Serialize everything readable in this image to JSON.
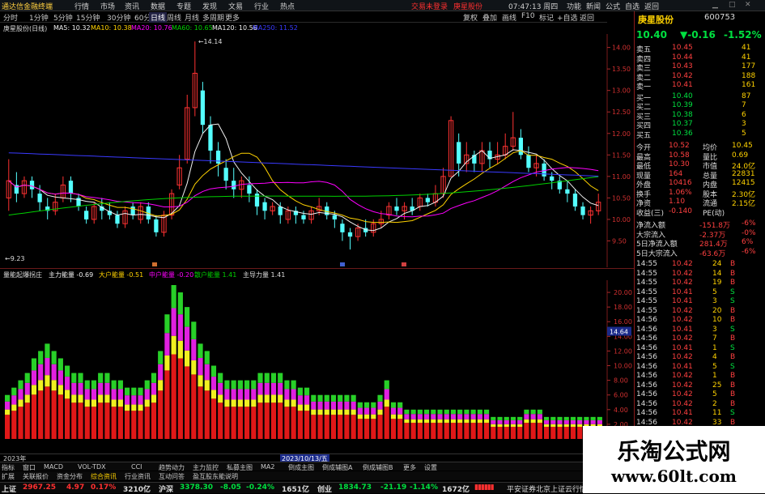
{
  "menubar": {
    "app_title": "通达信金融终端",
    "items": [
      "行情",
      "市场",
      "资讯",
      "数据",
      "专题",
      "发现",
      "文易",
      "行业",
      "热点"
    ],
    "login_links": [
      "交易未登录",
      "庚星股份"
    ],
    "right_items": [
      "功能",
      "新闻",
      "公式",
      "自选",
      "返回"
    ],
    "time": "07:47:13 周四"
  },
  "period_tabs": [
    "分时",
    "1分钟",
    "5分钟",
    "15分钟",
    "30分钟",
    "60分钟",
    "日线",
    "周线",
    "月线",
    "多周期",
    "更多"
  ],
  "period_right": [
    "复权",
    "叠加",
    "画线",
    "F10",
    "标记",
    "+自选",
    "返回"
  ],
  "ma_legend": {
    "name": "庚星股份(日线)",
    "ma5": "MA5: 10.32",
    "ma10": "MA10: 10.38",
    "ma20": "MA20: 10.76",
    "ma60": "MA60: 10.65",
    "ma120": "MA120: 10.56",
    "ma250": "MA250: 11.52"
  },
  "price_axis": [
    "14.00",
    "13.50",
    "13.00",
    "12.50",
    "12.00",
    "11.50",
    "11.00",
    "10.50",
    "10.00",
    "9.50"
  ],
  "chart_annotations": {
    "high": "14.14",
    "low": "9.23"
  },
  "chart_data": {
    "type": "candlestick",
    "ylim": [
      9.0,
      14.2
    ],
    "candles": [
      [
        10.5,
        10.9,
        10.2,
        11.4
      ],
      [
        10.8,
        10.6,
        10.4,
        11.1
      ],
      [
        10.6,
        10.9,
        10.5,
        11.0
      ],
      [
        10.9,
        10.7,
        10.5,
        11.0
      ],
      [
        10.6,
        10.4,
        10.2,
        10.8
      ],
      [
        10.3,
        10.2,
        10.0,
        10.5
      ],
      [
        10.2,
        10.4,
        10.1,
        10.6
      ],
      [
        10.5,
        10.8,
        10.4,
        11.0
      ],
      [
        10.9,
        10.6,
        10.4,
        11.0
      ],
      [
        10.5,
        10.3,
        10.2,
        10.6
      ],
      [
        10.2,
        10.0,
        9.9,
        10.3
      ],
      [
        10.0,
        10.3,
        9.9,
        10.4
      ],
      [
        10.3,
        10.2,
        10.0,
        10.5
      ],
      [
        10.2,
        10.1,
        10.0,
        10.4
      ],
      [
        10.1,
        9.9,
        9.8,
        10.2
      ],
      [
        9.9,
        10.2,
        9.8,
        10.3
      ],
      [
        10.3,
        10.1,
        10.0,
        10.4
      ],
      [
        10.0,
        10.3,
        9.9,
        10.4
      ],
      [
        10.3,
        10.0,
        9.9,
        10.4
      ],
      [
        10.0,
        9.7,
        9.6,
        10.1
      ],
      [
        9.7,
        10.1,
        9.6,
        10.2
      ],
      [
        10.1,
        10.6,
        10.0,
        10.7
      ],
      [
        10.8,
        11.2,
        10.7,
        11.5
      ],
      [
        11.4,
        12.6,
        11.3,
        12.9
      ],
      [
        12.6,
        13.4,
        12.4,
        14.14
      ],
      [
        13.0,
        12.2,
        12.0,
        13.2
      ],
      [
        12.2,
        11.6,
        11.3,
        12.4
      ],
      [
        11.6,
        11.3,
        11.0,
        11.8
      ],
      [
        11.2,
        10.9,
        10.7,
        11.4
      ],
      [
        10.9,
        10.7,
        10.5,
        11.2
      ],
      [
        10.7,
        10.9,
        10.5,
        11.0
      ],
      [
        10.8,
        10.6,
        10.4,
        11.0
      ],
      [
        10.6,
        10.3,
        10.1,
        10.7
      ],
      [
        10.4,
        10.2,
        10.0,
        10.5
      ],
      [
        10.2,
        10.3,
        10.1,
        10.4
      ],
      [
        10.3,
        10.1,
        9.9,
        10.4
      ],
      [
        10.0,
        10.2,
        9.9,
        10.3
      ],
      [
        10.2,
        10.1,
        9.9,
        10.3
      ],
      [
        10.1,
        10.0,
        9.9,
        10.2
      ],
      [
        10.0,
        10.2,
        9.9,
        10.3
      ],
      [
        10.2,
        10.3,
        10.1,
        10.5
      ],
      [
        10.3,
        10.1,
        10.0,
        10.4
      ],
      [
        10.1,
        10.0,
        9.8,
        10.2
      ],
      [
        9.9,
        9.7,
        9.5,
        10.0
      ],
      [
        9.7,
        9.6,
        9.3,
        9.8
      ],
      [
        9.6,
        9.8,
        9.5,
        9.9
      ],
      [
        9.8,
        9.7,
        9.6,
        10.0
      ],
      [
        9.7,
        9.9,
        9.6,
        10.0
      ],
      [
        9.9,
        10.0,
        9.8,
        10.2
      ],
      [
        10.1,
        10.3,
        10.0,
        10.4
      ],
      [
        10.3,
        10.2,
        10.1,
        10.5
      ],
      [
        10.2,
        10.3,
        10.0,
        10.4
      ],
      [
        10.3,
        10.2,
        10.1,
        10.5
      ],
      [
        10.3,
        10.5,
        10.2,
        10.6
      ],
      [
        10.5,
        10.4,
        10.3,
        10.6
      ],
      [
        10.4,
        10.6,
        10.3,
        10.8
      ],
      [
        10.6,
        11.0,
        10.5,
        11.2
      ],
      [
        11.0,
        12.3,
        11.0,
        12.4
      ],
      [
        11.8,
        11.3,
        11.0,
        12.0
      ],
      [
        11.3,
        11.5,
        11.1,
        11.8
      ],
      [
        11.5,
        11.3,
        11.1,
        11.6
      ],
      [
        11.3,
        11.6,
        11.1,
        11.8
      ],
      [
        11.6,
        11.4,
        11.2,
        11.8
      ],
      [
        11.4,
        11.5,
        11.3,
        11.8
      ],
      [
        11.5,
        11.7,
        11.4,
        12.0
      ],
      [
        11.7,
        11.9,
        11.6,
        12.5
      ],
      [
        11.9,
        11.5,
        11.4,
        12.1
      ],
      [
        11.5,
        11.2,
        11.1,
        11.7
      ],
      [
        11.2,
        11.3,
        11.0,
        11.5
      ],
      [
        11.3,
        11.0,
        10.9,
        11.4
      ],
      [
        11.0,
        10.9,
        10.7,
        11.1
      ],
      [
        10.9,
        10.7,
        10.6,
        11.0
      ],
      [
        10.7,
        10.6,
        10.4,
        10.9
      ],
      [
        10.6,
        10.3,
        10.2,
        10.7
      ],
      [
        10.3,
        10.1,
        10.0,
        10.4
      ],
      [
        10.1,
        10.2,
        9.9,
        10.3
      ],
      [
        10.2,
        10.4,
        10.1,
        10.6
      ]
    ],
    "ma_lines": [
      {
        "name": "MA5",
        "color": "#f0f0f0"
      },
      {
        "name": "MA10",
        "color": "#ffd200"
      },
      {
        "name": "MA20",
        "color": "#ff00ff"
      },
      {
        "name": "MA60",
        "color": "#00d000"
      },
      {
        "name": "MA120",
        "color": "#3a3aff"
      }
    ]
  },
  "date_markers": [
    "2023年",
    "2023/10/13/五"
  ],
  "indicator_legend": {
    "name": "量能起爆拐庄",
    "main": "主力能量 -0.69",
    "big": "大户能量 -0.51",
    "mid": "中户能量 -0.20",
    "retail": "散户能量 1.41",
    "leader": "主导力量 1.41"
  },
  "indicator_axis": [
    "20.00",
    "18.00",
    "16.00",
    "14.00",
    "12.00",
    "10.00",
    "8.00",
    "6.00",
    "4.00",
    "2.00"
  ],
  "indicator_tag": "14.64",
  "indicator_tag2": "3.0",
  "indicator_data": {
    "total": [
      6,
      7,
      8,
      9,
      11,
      12,
      13,
      12,
      11,
      10,
      9,
      9,
      8,
      8,
      9,
      9,
      8,
      8,
      7,
      7,
      7,
      8,
      9,
      12,
      17,
      21,
      20,
      18,
      16,
      13,
      12,
      10,
      9,
      8,
      8,
      8,
      8,
      8,
      9,
      9,
      9,
      9,
      8,
      8,
      7,
      7,
      6,
      6,
      6,
      6,
      6,
      6,
      6,
      5,
      5,
      5,
      6,
      8,
      5,
      5,
      4,
      4,
      4,
      4,
      4,
      4,
      4,
      4,
      4,
      4,
      4,
      4,
      4,
      3,
      3,
      3,
      3,
      3,
      4,
      4,
      4,
      3,
      3,
      3,
      3,
      3,
      3,
      3,
      3,
      3
    ],
    "red_ratio": 0.55,
    "yellow_ratio": 0.12,
    "magenta_ratio": 0.18
  },
  "right_panel": {
    "title": "庚星股份",
    "code": "600753",
    "price": "10.40",
    "change": "▼-0.16",
    "change_pct": "-1.52%",
    "asks": [
      [
        "卖五",
        "10.45",
        "41"
      ],
      [
        "卖四",
        "10.44",
        "41"
      ],
      [
        "卖三",
        "10.43",
        "177"
      ],
      [
        "卖二",
        "10.42",
        "188"
      ],
      [
        "卖一",
        "10.41",
        "161"
      ]
    ],
    "bids": [
      [
        "买一",
        "10.40",
        "87"
      ],
      [
        "买二",
        "10.39",
        "7"
      ],
      [
        "买三",
        "10.38",
        "6"
      ],
      [
        "买四",
        "10.37",
        "3"
      ],
      [
        "买五",
        "10.36",
        "5"
      ]
    ],
    "stats": [
      [
        "今开",
        "10.52",
        "均价",
        "10.45"
      ],
      [
        "最高",
        "10.58",
        "量比",
        "0.69"
      ],
      [
        "最低",
        "10.30",
        "市值",
        "24.0亿"
      ],
      [
        "现量",
        "164",
        "总量",
        "22831"
      ],
      [
        "外盘",
        "10416",
        "内盘",
        "12415"
      ],
      [
        "换手",
        "1.06%",
        "股本",
        "2.30亿"
      ],
      [
        "净资",
        "1.10",
        "流通",
        "2.15亿"
      ],
      [
        "收益(三)",
        "-0.140",
        "PE(动)",
        ""
      ]
    ],
    "flows": [
      [
        "净流入额",
        "-151.8万",
        "-6%"
      ],
      [
        "大宗流入",
        "-2.37万",
        "-0%"
      ],
      [
        "5日净流入额",
        "281.4万",
        "6%"
      ],
      [
        "5日大宗流入",
        "-63.6万",
        "-6%"
      ]
    ],
    "ticks": [
      [
        "14:55",
        "10.42",
        "24",
        "B"
      ],
      [
        "14:55",
        "10.42",
        "14",
        "B"
      ],
      [
        "14:55",
        "10.42",
        "19",
        "B"
      ],
      [
        "14:55",
        "10.41",
        "5",
        "S"
      ],
      [
        "14:55",
        "10.41",
        "3",
        "S"
      ],
      [
        "14:55",
        "10.42",
        "20",
        "B"
      ],
      [
        "14:56",
        "10.42",
        "10",
        "B"
      ],
      [
        "14:56",
        "10.41",
        "3",
        "S"
      ],
      [
        "14:56",
        "10.42",
        "7",
        "B"
      ],
      [
        "14:56",
        "10.41",
        "1",
        "S"
      ],
      [
        "14:56",
        "10.42",
        "4",
        "B"
      ],
      [
        "14:56",
        "10.41",
        "5",
        "S"
      ],
      [
        "14:56",
        "10.42",
        "1",
        "B"
      ],
      [
        "14:56",
        "10.42",
        "25",
        "B"
      ],
      [
        "14:56",
        "10.42",
        "5",
        "B"
      ],
      [
        "14:56",
        "10.42",
        "2",
        "B"
      ],
      [
        "14:56",
        "10.41",
        "11",
        "S"
      ],
      [
        "14:56",
        "10.42",
        "33",
        "B"
      ]
    ]
  },
  "tabs_row1": [
    "指标",
    "窗口",
    "MACD",
    "VOL-TDX",
    "CCI",
    "趋势动力",
    "主力监控",
    "私募主图",
    "MA2",
    "倒成主图",
    "倒成辅图A",
    "倒成辅图B",
    "更多",
    "设置"
  ],
  "tabs_row2": [
    "扩展",
    "关联报价",
    "资金分布",
    "综合资讯",
    "行业资讯",
    "互动问答",
    "盈互股东能说明"
  ],
  "ticker": {
    "sh_label": "上证",
    "sh_val": "2967.25",
    "sh_chg": "4.97",
    "sh_pct": "0.17%",
    "sh_amt": "3210亿",
    "sz_label": "沪深",
    "sz_val": "3378.30",
    "sz_chg": "-8.05",
    "sz_pct": "-0.24%",
    "sz_amt": "1651亿",
    "cy_label": "创业",
    "cy_val": "1834.73",
    "cy_chg": "-21.19",
    "cy_pct": "-1.14%",
    "cy_amt": "1672亿",
    "broker": "平安证券北京上证云行情"
  },
  "watermark": {
    "line1": "乐淘公式网",
    "line2": "www.60lt.com"
  }
}
